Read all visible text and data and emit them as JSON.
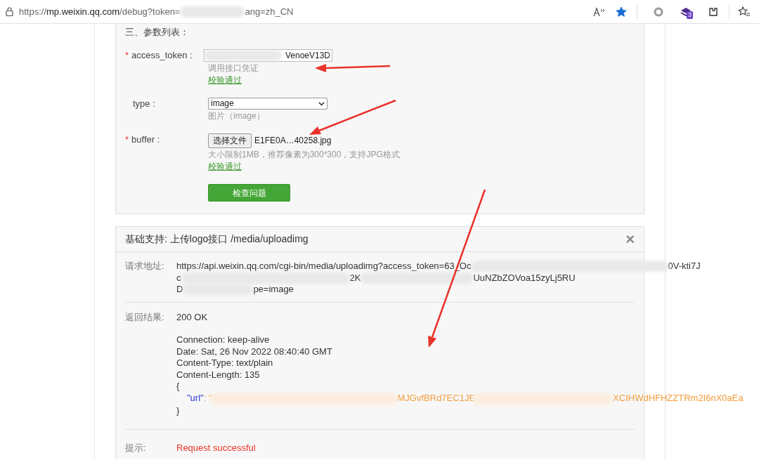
{
  "address_bar": {
    "url_scheme": "https://",
    "url_host": "mp.weixin.qq.com",
    "url_path": "/debug?token=",
    "url_tail": "ang=zh_CN",
    "extension_badge": "3",
    "favorite": true
  },
  "params": {
    "title": "三、参数列表：",
    "fields": [
      {
        "kind": "input",
        "label": "access_token :",
        "required": true,
        "required_mark": "*",
        "value": "VenoeV13D",
        "hint": "调用接口凭证",
        "validation": "校验通过"
      },
      {
        "kind": "select",
        "label": "type :",
        "required": false,
        "value": "image",
        "hint": "图片（image）"
      },
      {
        "kind": "file",
        "label": "buffer :",
        "required": true,
        "required_mark": "*",
        "button": "选择文件",
        "value": "E1FE0A…40258.jpg",
        "hint": "大小限制1MB，推荐像素为300*300，支持JPG格式",
        "validation": "校验通过"
      }
    ],
    "submit": "检查问题"
  },
  "result": {
    "title": "基础支持: 上传logo接口 /media/uploadimg",
    "close": "×",
    "request_label": "请求地址:",
    "request_lines": [
      [
        "https://api.weixin.qq.com/cgi-bin/media/uploadimg?access_token=63_Oc",
        "0V-kti7J"
      ],
      [
        "c",
        "2K",
        "UuNZbZOVoa15zyLj5RU"
      ],
      [
        "D",
        "pe=image"
      ]
    ],
    "response_label": "返回结果:",
    "status": "200 OK",
    "headers": [
      "Connection: keep-alive",
      "Date: Sat, 26 Nov 2022 08:40:40 GMT",
      "Content-Type: text/plain",
      "Content-Length: 135"
    ],
    "open_brace": "{",
    "json_key": "\"url\"",
    "json_sep": ": \"",
    "json_fragments": [
      "MJGvfBRd7EC1JE",
      "XCIHWdHFHZZTRm2I6nX0aEa"
    ],
    "close_brace": "}",
    "tip_label": "提示:",
    "tip": "Request successful"
  }
}
